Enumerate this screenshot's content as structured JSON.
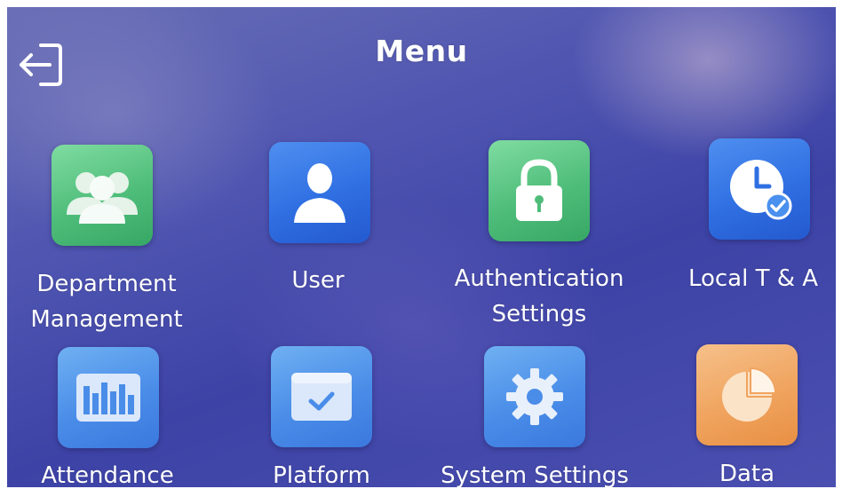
{
  "header": {
    "title": "Menu",
    "back_icon": "back-exit-icon"
  },
  "menu": {
    "items": [
      {
        "label": "Department\nManagement",
        "icon": "department-group-icon",
        "color": "#4fbd7a"
      },
      {
        "label": "User",
        "icon": "user-icon",
        "color": "#2f6fe2"
      },
      {
        "label": "Authentication\nSettings",
        "icon": "lock-icon",
        "color": "#4fbd7a"
      },
      {
        "label": "Local T & A",
        "icon": "clock-check-icon",
        "color": "#2f6fe2"
      },
      {
        "label": "Attendance",
        "icon": "attendance-bars-icon",
        "color": "#4a8de8"
      },
      {
        "label": "Platform",
        "icon": "platform-icon",
        "color": "#4a8de8"
      },
      {
        "label": "System Settings",
        "icon": "gear-icon",
        "color": "#4a8de8"
      },
      {
        "label": "Data",
        "icon": "pie-chart-icon",
        "color": "#f0a45f"
      }
    ]
  }
}
